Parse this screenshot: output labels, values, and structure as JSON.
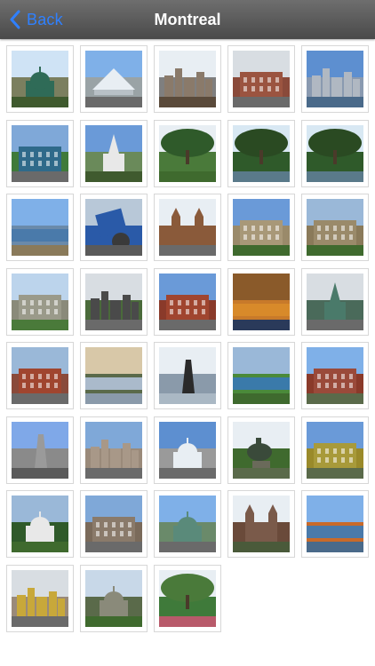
{
  "nav": {
    "back_label": "Back",
    "title": "Montreal",
    "accent_color": "#2f80ff",
    "back_icon": "chevron-left-icon"
  },
  "photos": [
    {
      "sky": "#cfe3f5",
      "mid": "#7b7f5f",
      "ground": "#3f5a2e",
      "subject": "dome",
      "subject_color": "#2f6b57"
    },
    {
      "sky": "#7fb0e8",
      "mid": "#9aa3a6",
      "ground": "#6a6a6a",
      "subject": "tent",
      "subject_color": "#e8eef3"
    },
    {
      "sky": "#e8eef3",
      "mid": "#7f7f7f",
      "ground": "#5a4a3a",
      "subject": "city",
      "subject_color": "#8a7a6a"
    },
    {
      "sky": "#d8dde2",
      "mid": "#8a4a3a",
      "ground": "#6a6a6a",
      "subject": "building",
      "subject_color": "#9b5440"
    },
    {
      "sky": "#5d8fd0",
      "mid": "#8a9ab0",
      "ground": "#4a6a8a",
      "subject": "city",
      "subject_color": "#b0b8c2"
    },
    {
      "sky": "#7fa8d8",
      "mid": "#3f7a3a",
      "ground": "#6a6a6a",
      "subject": "building",
      "subject_color": "#2f6a8a"
    },
    {
      "sky": "#6a9ad8",
      "mid": "#6a8a5a",
      "ground": "#3f5a2e",
      "subject": "church",
      "subject_color": "#e8e8e8"
    },
    {
      "sky": "#e8eef3",
      "mid": "#4a7a3a",
      "ground": "#3f6a2e",
      "subject": "tree",
      "subject_color": "#2f5a2a"
    },
    {
      "sky": "#d8e8f3",
      "mid": "#2f5a2a",
      "ground": "#5a7a8a",
      "subject": "tree",
      "subject_color": "#2a4a22"
    },
    {
      "sky": "#d8e8f3",
      "mid": "#2f5a2a",
      "ground": "#5a7a8a",
      "subject": "tree",
      "subject_color": "#2a4a22"
    },
    {
      "sky": "#7fb0e8",
      "mid": "#6a8aaa",
      "ground": "#8a7a5a",
      "subject": "water",
      "subject_color": "#4a7aaa"
    },
    {
      "sky": "#b8c8d8",
      "mid": "#2a5aa8",
      "ground": "#5a5a5a",
      "subject": "sign",
      "subject_color": "#2a5aa8"
    },
    {
      "sky": "#e8eef3",
      "mid": "#8a5a3a",
      "ground": "#6a6a6a",
      "subject": "cathedral",
      "subject_color": "#8a5a3a"
    },
    {
      "sky": "#6a9ad8",
      "mid": "#9a8a6a",
      "ground": "#3f6a2e",
      "subject": "building",
      "subject_color": "#a89878"
    },
    {
      "sky": "#9ab8d8",
      "mid": "#8a7a5a",
      "ground": "#3f6a2e",
      "subject": "building",
      "subject_color": "#9a8a6a"
    },
    {
      "sky": "#bcd4ec",
      "mid": "#8a8a7a",
      "ground": "#4a7a3a",
      "subject": "building",
      "subject_color": "#9a9a8a"
    },
    {
      "sky": "#d8dde2",
      "mid": "#4a6a3a",
      "ground": "#6a6a6a",
      "subject": "city",
      "subject_color": "#4a4a4a"
    },
    {
      "sky": "#6a9ad8",
      "mid": "#8a3a2a",
      "ground": "#6a6a6a",
      "subject": "building",
      "subject_color": "#a0452f"
    },
    {
      "sky": "#8a5a2a",
      "mid": "#c87a2a",
      "ground": "#2a3a5a",
      "subject": "water",
      "subject_color": "#d88a2a"
    },
    {
      "sky": "#d8dde2",
      "mid": "#4a6a5a",
      "ground": "#6a6a6a",
      "subject": "church",
      "subject_color": "#4a7a6a"
    },
    {
      "sky": "#9ab8d8",
      "mid": "#8a4a3a",
      "ground": "#6a6a6a",
      "subject": "building",
      "subject_color": "#a0452f"
    },
    {
      "sky": "#d8c8a8",
      "mid": "#5a6a4a",
      "ground": "#8a9aaa",
      "subject": "water",
      "subject_color": "#aabacb"
    },
    {
      "sky": "#e8eef3",
      "mid": "#8a9aaa",
      "ground": "#aab8c4",
      "subject": "tower",
      "subject_color": "#2a2a2a"
    },
    {
      "sky": "#9ab8d8",
      "mid": "#4a8a3a",
      "ground": "#3f6a2e",
      "subject": "water",
      "subject_color": "#3a7aaa"
    },
    {
      "sky": "#7fb0e8",
      "mid": "#8a3a2a",
      "ground": "#5a6a4a",
      "subject": "building",
      "subject_color": "#9a4a3a"
    },
    {
      "sky": "#7fa8e8",
      "mid": "#8a8a8a",
      "ground": "#5a5a5a",
      "subject": "tower",
      "subject_color": "#9a9a9a"
    },
    {
      "sky": "#7fa8d8",
      "mid": "#9a8a7a",
      "ground": "#6a6a6a",
      "subject": "city",
      "subject_color": "#a89888"
    },
    {
      "sky": "#5d8fd0",
      "mid": "#9a9a9a",
      "ground": "#6a6a6a",
      "subject": "dome",
      "subject_color": "#e8eef3"
    },
    {
      "sky": "#e8eef3",
      "mid": "#3f6a2e",
      "ground": "#5a6a4a",
      "subject": "statue",
      "subject_color": "#3a4a3a"
    },
    {
      "sky": "#6a9ad8",
      "mid": "#9a8a2a",
      "ground": "#5a6a4a",
      "subject": "building",
      "subject_color": "#a89a3a"
    },
    {
      "sky": "#9ab8d8",
      "mid": "#2f5a2a",
      "ground": "#3f6a2e",
      "subject": "dome",
      "subject_color": "#e8e8e8"
    },
    {
      "sky": "#7fa8d8",
      "mid": "#7a6a5a",
      "ground": "#6a6a6a",
      "subject": "building",
      "subject_color": "#8a7a6a"
    },
    {
      "sky": "#7fb0e8",
      "mid": "#6a8a6a",
      "ground": "#6a6a6a",
      "subject": "dome",
      "subject_color": "#5a8a7a"
    },
    {
      "sky": "#e8eef3",
      "mid": "#6a4a3a",
      "ground": "#4a5a3a",
      "subject": "cathedral",
      "subject_color": "#7a5a4a"
    },
    {
      "sky": "#7fb0e8",
      "mid": "#c86a2a",
      "ground": "#4a6a8a",
      "subject": "water",
      "subject_color": "#4a7aaa"
    },
    {
      "sky": "#d8dde2",
      "mid": "#9a8a7a",
      "ground": "#6a6a6a",
      "subject": "city",
      "subject_color": "#c8a83a"
    },
    {
      "sky": "#c8d8e8",
      "mid": "#5a6a4a",
      "ground": "#3f6a2e",
      "subject": "dome",
      "subject_color": "#8a8a7a"
    },
    {
      "sky": "#e8eef3",
      "mid": "#3f7a3a",
      "ground": "#b85a6a",
      "subject": "tree",
      "subject_color": "#4a7a3a"
    }
  ]
}
